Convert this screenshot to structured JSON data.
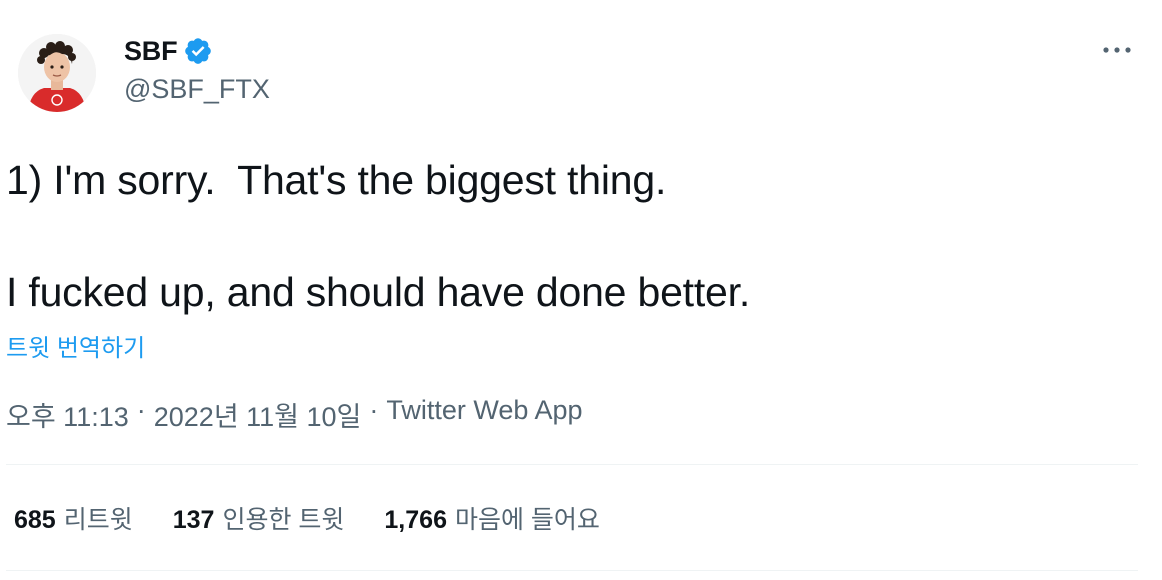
{
  "author": {
    "name": "SBF",
    "handle": "@SBF_FTX",
    "verified": true,
    "avatar_icon": "profile-avatar"
  },
  "tweet": {
    "line1": "1) I'm sorry.  That's the biggest thing.",
    "line2": "I fucked up, and should have done better.",
    "translate_label": "트윗 번역하기"
  },
  "meta": {
    "time": "오후 11:13",
    "sep1": "·",
    "date": "2022년 11월 10일",
    "sep2": "·",
    "source": "Twitter Web App"
  },
  "stats": {
    "retweets_count": "685",
    "retweets_label": "리트윗",
    "quotes_count": "137",
    "quotes_label": "인용한 트윗",
    "likes_count": "1,766",
    "likes_label": "마음에 들어요"
  },
  "colors": {
    "accent": "#1d9bf0",
    "text": "#0f1419",
    "secondary": "#536471",
    "divider": "#eff3f4"
  }
}
